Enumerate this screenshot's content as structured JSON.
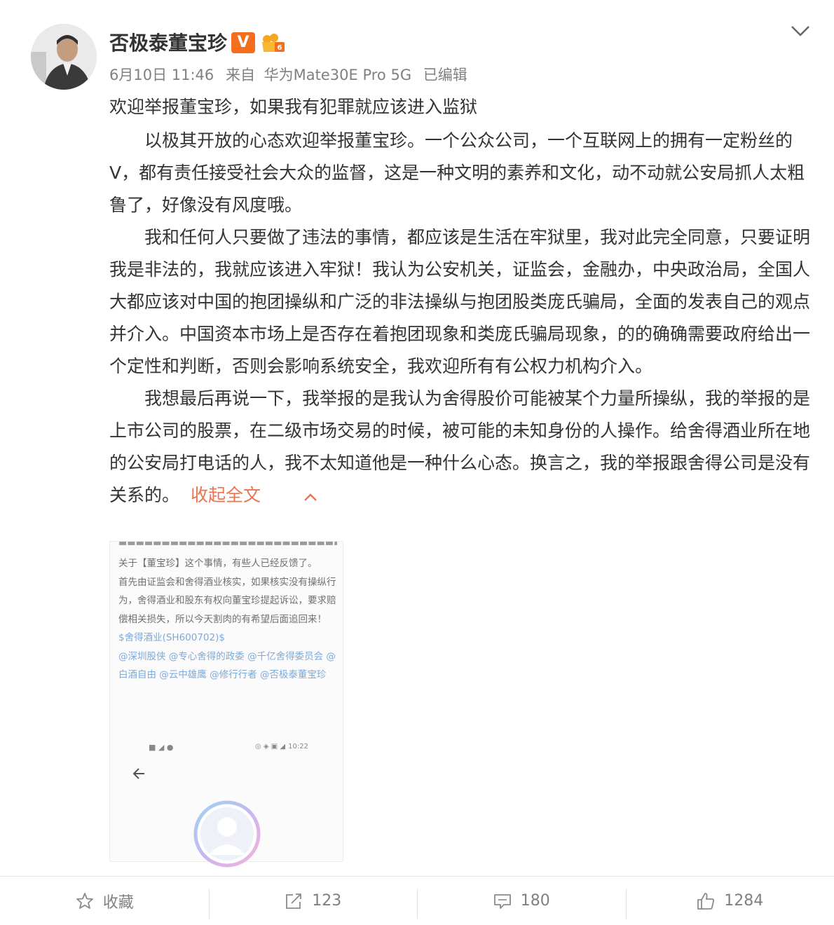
{
  "post": {
    "author": "否极泰董宝珍",
    "badges": {
      "verified": "V"
    },
    "meta": {
      "date": "6月10日 11:46",
      "source_prefix": "来自",
      "device": "华为Mate30E Pro 5G",
      "edited": "已编辑"
    },
    "title": "欢迎举报董宝珍，如果我有犯罪就应该进入监狱",
    "paragraphs": [
      "以极其开放的心态欢迎举报董宝珍。一个公众公司，一个互联网上的拥有一定粉丝的V，都有责任接受社会大众的监督，这是一种文明的素养和文化，动不动就公安局抓人太粗鲁了，好像没有风度哦。",
      "我和任何人只要做了违法的事情，都应该是生活在牢狱里，我对此完全同意，只要证明我是非法的，我就应该进入牢狱！我认为公安机关，证监会，金融办，中央政治局，全国人大都应该对中国的抱团操纵和广泛的非法操纵与抱团股类庞氏骗局，全面的发表自己的观点并介入。中国资本市场上是否存在着抱团现象和类庞氏骗局现象，的的确确需要政府给出一个定性和判断，否则会影响系统安全，我欢迎所有有公权力机构介入。",
      "我想最后再说一下，我举报的是我认为舍得股价可能被某个力量所操纵，我的举报的是上市公司的股票，在二级市场交易的时候，被可能的未知身份的人操作。给舍得酒业所在地的公安局打电话的人，我不太知道他是一种什么心态。换言之，我的举报跟舍得公司是没有关系的。"
    ],
    "collapse_label": "收起全文",
    "image": {
      "line1": "关于【董宝珍】这个事情，有些人已经反馈了。",
      "line2": "首先由证监会和舍得酒业核实，如果核实没有操纵行为，舍得酒业和股东有权向董宝珍提起诉讼，要求赔偿相关损失，所以今天割肉的有希望后面追回来！",
      "stock": "$舍得酒业(SH600702)$",
      "mentions": "@深圳股侠 @专心舍得的政委 @千亿舍得委员会 @白酒自由 @云中雄鹰 @修行行者 @否极泰董宝珍",
      "status_time": "10:22"
    }
  },
  "actions": {
    "favorite_label": "收藏",
    "repost_count": "123",
    "comment_count": "180",
    "like_count": "1284"
  },
  "colors": {
    "link_orange": "#eb7350",
    "badge_orange": "#f46e1e",
    "text": "#333333",
    "meta_gray": "#808080"
  },
  "icons": [
    "chevron-down-icon",
    "star-icon",
    "repost-icon",
    "comment-icon",
    "like-icon",
    "back-arrow-icon"
  ]
}
